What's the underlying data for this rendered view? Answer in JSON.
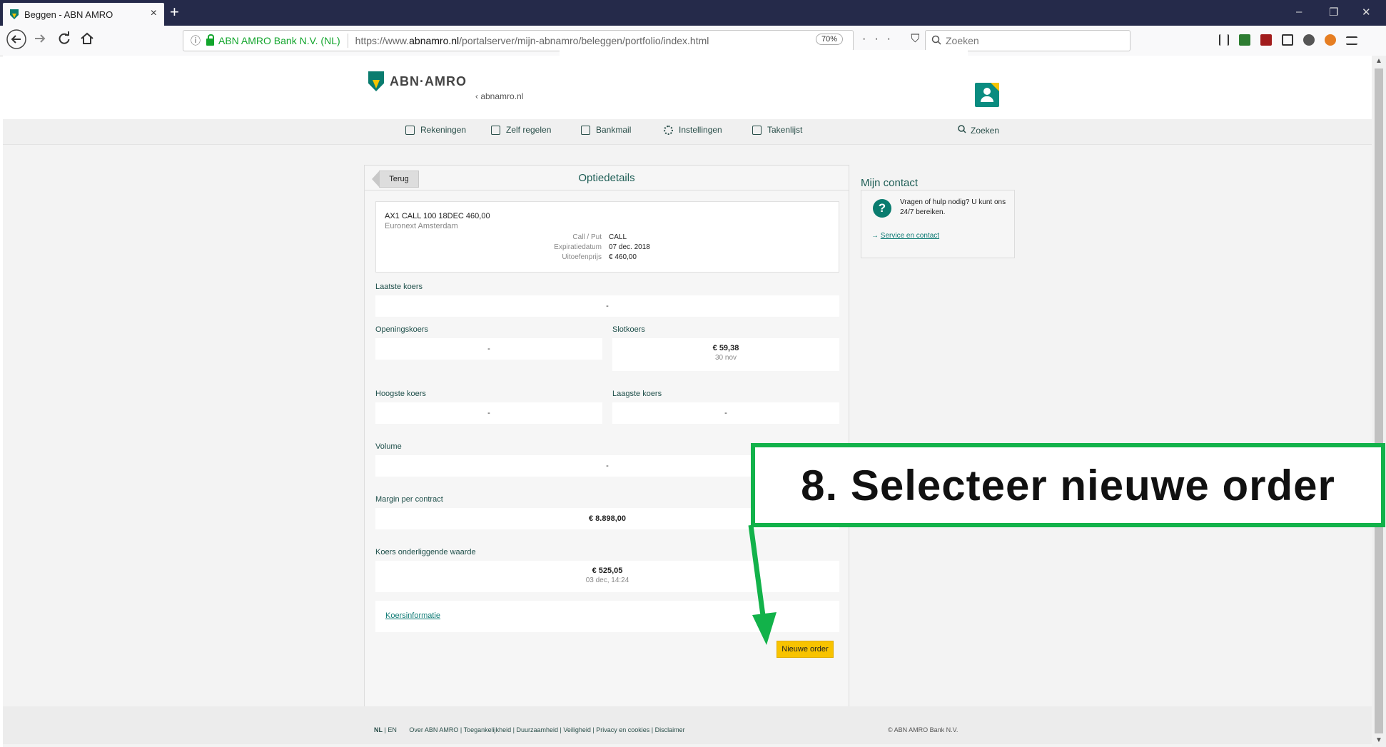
{
  "browser": {
    "tab_title": "Beggen - ABN AMRO",
    "tab_close": "×",
    "new_tab": "+",
    "site_identity": "ABN AMRO Bank N.V. (NL)",
    "url_prefix": "https://www.",
    "url_domain": "abnamro.nl",
    "url_path": "/portalserver/mijn-abnamro/beleggen/portfolio/index.html",
    "zoom": "70%",
    "page_actions": "··· ⛉ ☆",
    "search_placeholder": "Zoeken",
    "window_min": "–",
    "window_restore": "❐",
    "window_close": "✕"
  },
  "header": {
    "logo_text": "ABN·AMRO",
    "back_link": "‹ abnamro.nl"
  },
  "menu": {
    "items": [
      "Rekeningen",
      "Zelf regelen",
      "Bankmail",
      "Instellingen",
      "Takenlijst"
    ],
    "search": "Zoeken"
  },
  "card": {
    "back_button": "Terug",
    "title": "Optiedetails",
    "instrument": "AX1 CALL 100 18DEC 460,00",
    "exchange": "Euronext Amsterdam",
    "details": [
      {
        "key": "Call / Put",
        "value": "CALL"
      },
      {
        "key": "Expiratiedatum",
        "value": "07 dec. 2018"
      },
      {
        "key": "Uitoefenprijs",
        "value": "€ 460,00"
      }
    ],
    "fields": {
      "laatste_koers": {
        "label": "Laatste koers",
        "value": "-"
      },
      "openingskoers": {
        "label": "Openingskoers",
        "value": "-"
      },
      "slotkoers": {
        "label": "Slotkoers",
        "value": "€ 59,38",
        "sub": "30 nov"
      },
      "hoogste_koers": {
        "label": "Hoogste koers",
        "value": "-"
      },
      "laagste_koers": {
        "label": "Laagste koers",
        "value": "-"
      },
      "volume": {
        "label": "Volume",
        "value": "-"
      },
      "margin": {
        "label": "Margin per contract",
        "value": "€ 8.898,00"
      },
      "koers_onderliggende": {
        "label": "Koers onderliggende waarde",
        "value": "€ 525,05",
        "sub": "03 dec, 14:24"
      }
    },
    "koersinformatie_link": "Koersinformatie",
    "new_order_button": "Nieuwe order"
  },
  "contact": {
    "title": "Mijn contact",
    "question_mark": "?",
    "text": "Vragen of hulp nodig? U kunt ons 24/7 bereiken.",
    "arrow": "→ ",
    "link": "Service en contact"
  },
  "footer": {
    "lang_nl": "NL",
    "lang_en": "EN",
    "links": [
      "Over ABN AMRO",
      "Toegankelijkheid",
      "Duurzaamheid",
      "Veiligheid",
      "Privacy en cookies",
      "Disclaimer"
    ],
    "copyright": "© ABN AMRO Bank N.V."
  },
  "annotation": {
    "text": "8.  Selecteer nieuwe order",
    "color": "#12b24a"
  }
}
